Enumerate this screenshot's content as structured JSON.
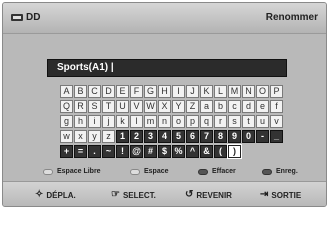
{
  "header": {
    "icon": "dd-icon",
    "title": "DD",
    "action": "Renommer"
  },
  "field": {
    "value": "Sports(A1) |"
  },
  "keyboard": {
    "rows": [
      [
        "A",
        "B",
        "C",
        "D",
        "E",
        "F",
        "G",
        "H",
        "I",
        "J",
        "K",
        "L",
        "M",
        "N",
        "O",
        "P"
      ],
      [
        "Q",
        "R",
        "S",
        "T",
        "U",
        "V",
        "W",
        "X",
        "Y",
        "Z",
        "a",
        "b",
        "c",
        "d",
        "e",
        "f"
      ],
      [
        "g",
        "h",
        "i",
        "j",
        "k",
        "l",
        "m",
        "n",
        "o",
        "p",
        "q",
        "r",
        "s",
        "t",
        "u",
        "v"
      ],
      [
        "w",
        "x",
        "y",
        "z",
        "1",
        "2",
        "3",
        "4",
        "5",
        "6",
        "7",
        "8",
        "9",
        "0",
        "-",
        "_"
      ],
      [
        "+",
        "=",
        ".",
        "~",
        "!",
        "@",
        "#",
        "$",
        "%",
        "^",
        "&",
        "(",
        ")"
      ]
    ],
    "selected": ")"
  },
  "color_buttons": [
    {
      "icon": "a-button-icon",
      "label": "Espace Libre"
    },
    {
      "icon": "b-button-icon",
      "label": "Espace"
    },
    {
      "icon": "c-button-icon",
      "label": "Effacer"
    },
    {
      "icon": "d-button-icon",
      "label": "Enreg."
    }
  ],
  "footer": [
    {
      "icon": "move-arrows-icon",
      "glyph": "✧",
      "label": "DÉPLA."
    },
    {
      "icon": "select-icon",
      "glyph": "☞",
      "label": "SELECT."
    },
    {
      "icon": "return-icon",
      "glyph": "↺",
      "label": "REVENIR"
    },
    {
      "icon": "exit-icon",
      "glyph": "⇥",
      "label": "SORTIE"
    }
  ]
}
